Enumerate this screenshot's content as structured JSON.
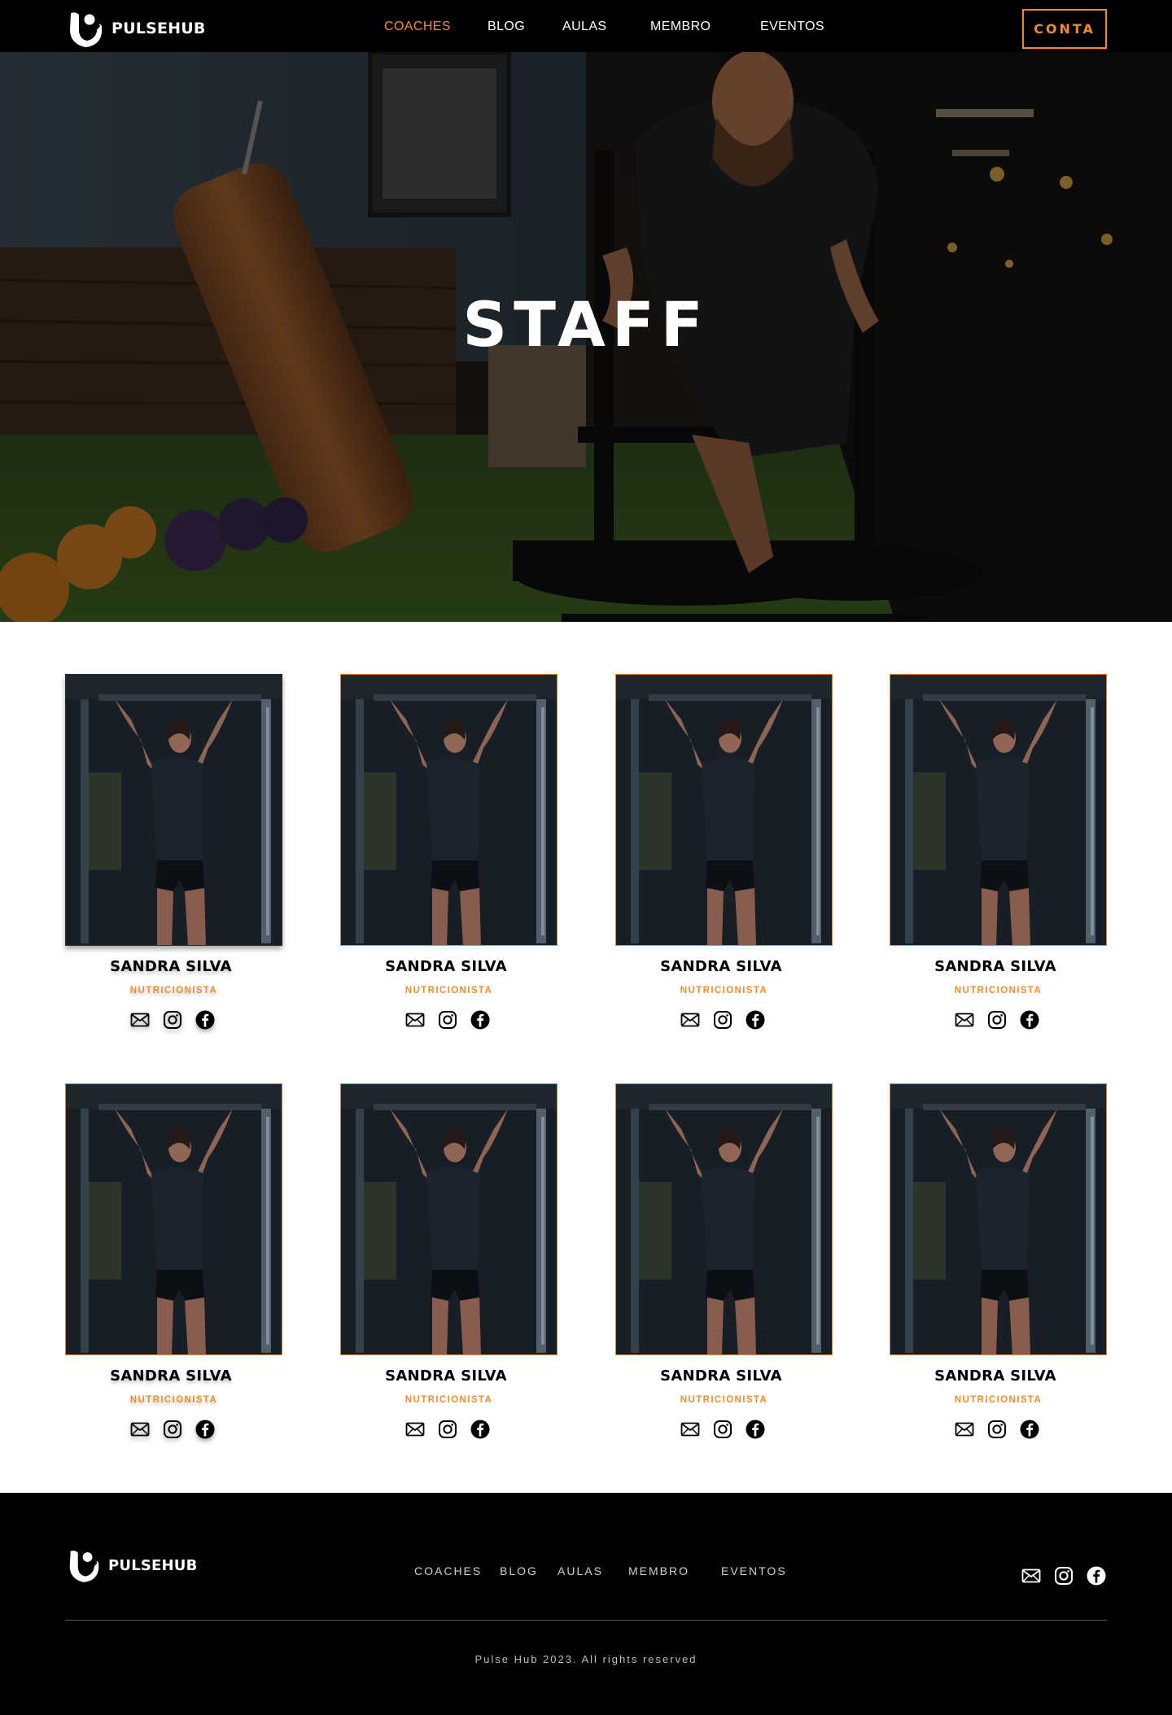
{
  "brand": {
    "name": "PULSEHUB"
  },
  "nav": {
    "links": [
      "COACHES",
      "BLOG",
      "AULAS",
      "MEMBRO",
      "EVENTOS"
    ],
    "active": "COACHES",
    "account_button": "CONTA"
  },
  "hero": {
    "title": "STAFF"
  },
  "staff": [
    {
      "name": "SANDRA SILVA",
      "role": "NUTRICIONISTA"
    },
    {
      "name": "SANDRA SILVA",
      "role": "NUTRICIONISTA"
    },
    {
      "name": "SANDRA SILVA",
      "role": "NUTRICIONISTA"
    },
    {
      "name": "SANDRA SILVA",
      "role": "NUTRICIONISTA"
    },
    {
      "name": "SANDRA SILVA",
      "role": "NUTRICIONISTA"
    },
    {
      "name": "SANDRA SILVA",
      "role": "NUTRICIONISTA"
    },
    {
      "name": "SANDRA SILVA",
      "role": "NUTRICIONISTA"
    },
    {
      "name": "SANDRA SILVA",
      "role": "NUTRICIONISTA"
    }
  ],
  "social_icons": [
    "mail-icon",
    "instagram-icon",
    "facebook-icon"
  ],
  "footer": {
    "links": [
      "COACHES",
      "BLOG",
      "AULAS",
      "MEMBRO",
      "EVENTOS"
    ],
    "copyright": "Pulse Hub 2023. All rights reserved"
  },
  "colors": {
    "accent": "#f28c28",
    "dark": "#000000"
  }
}
